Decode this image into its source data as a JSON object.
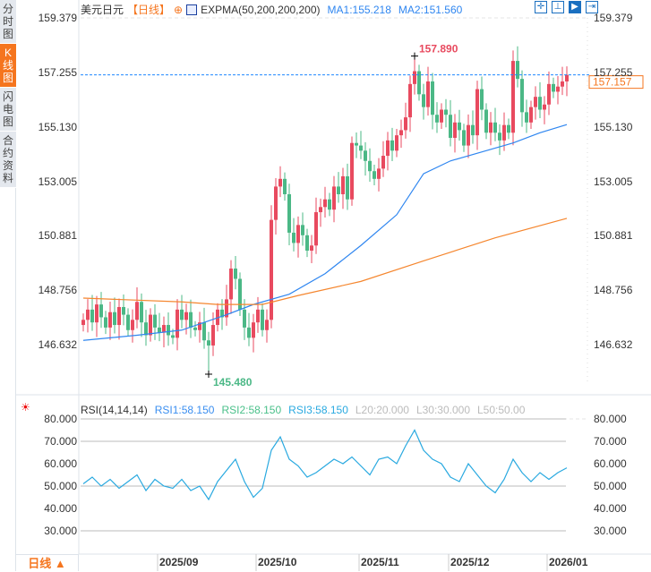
{
  "side_tabs": [
    {
      "label": "分\n时\n图",
      "active": false
    },
    {
      "label": "K\n线\n图",
      "active": true
    },
    {
      "label": "闪\n电\n图",
      "active": false
    },
    {
      "label": "合\n约\n资\n料",
      "active": false
    }
  ],
  "header": {
    "symbol": "美元日元",
    "period": "【日线】",
    "indicator": "EXPMA(50,200,200,200)",
    "ma1": "MA1:155.218",
    "ma2": "MA2:151.560"
  },
  "toolbar": [
    {
      "name": "crosshair",
      "active": false
    },
    {
      "name": "range",
      "active": false
    },
    {
      "name": "play",
      "active": true
    },
    {
      "name": "goto-end",
      "active": false
    }
  ],
  "price_axis": {
    "ticks": [
      "159.379",
      "157.255",
      "155.130",
      "153.005",
      "150.881",
      "148.756",
      "146.632"
    ],
    "tick_values": [
      159.379,
      157.255,
      155.13,
      153.005,
      150.881,
      148.756,
      146.632
    ],
    "current": "157.157",
    "current_value": 157.157
  },
  "annotations": {
    "high": "157.890",
    "high_value": 157.89,
    "high_index": 74,
    "low": "145.480",
    "low_value": 145.48,
    "low_index": 28
  },
  "colors": {
    "up": "#e84a5f",
    "down": "#4bb886",
    "ma1": "#2f86f0",
    "ma2": "#f5862e",
    "rsi": "#29a9e0",
    "accent": "#f5751e"
  },
  "chart_data": {
    "type": "candlestick",
    "close": [
      147.6,
      148.0,
      147.5,
      148.2,
      147.7,
      147.3,
      147.9,
      147.4,
      148.1,
      147.8,
      147.2,
      147.6,
      148.3,
      147.5,
      147.0,
      147.8,
      147.3,
      147.1,
      147.4,
      147.0,
      146.9,
      148.0,
      147.6,
      147.9,
      147.3,
      147.2,
      147.5,
      146.8,
      146.6,
      147.4,
      148.0,
      147.7,
      148.4,
      149.6,
      149.2,
      148.0,
      147.3,
      146.9,
      147.5,
      148.0,
      147.2,
      147.6,
      151.5,
      152.8,
      153.1,
      152.5,
      151.0,
      150.6,
      151.3,
      150.9,
      150.3,
      150.5,
      151.8,
      152.0,
      152.3,
      151.9,
      152.8,
      152.5,
      153.2,
      152.3,
      154.5,
      154.4,
      154.2,
      153.8,
      153.4,
      153.1,
      153.5,
      154.0,
      154.6,
      154.2,
      154.8,
      155.0,
      155.5,
      156.8,
      157.3,
      156.4,
      155.9,
      156.9,
      155.6,
      155.3,
      155.8,
      155.6,
      154.7,
      155.3,
      155.0,
      154.4,
      155.2,
      154.8,
      156.6,
      155.8,
      154.9,
      155.3,
      154.9,
      154.6,
      155.2,
      154.9,
      157.7,
      157.0,
      155.7,
      155.3,
      155.9,
      156.3,
      155.8,
      156.0,
      156.8,
      156.5,
      156.7,
      156.9,
      157.157
    ],
    "ma1": [
      [
        0,
        146.8
      ],
      [
        12,
        147.0
      ],
      [
        22,
        147.2
      ],
      [
        32,
        147.8
      ],
      [
        38,
        148.2
      ],
      [
        46,
        148.6
      ],
      [
        54,
        149.4
      ],
      [
        62,
        150.5
      ],
      [
        70,
        151.7
      ],
      [
        76,
        153.3
      ],
      [
        82,
        153.8
      ],
      [
        90,
        154.2
      ],
      [
        96,
        154.5
      ],
      [
        102,
        154.9
      ],
      [
        108,
        155.218
      ]
    ],
    "ma2": [
      [
        0,
        148.45
      ],
      [
        22,
        148.3
      ],
      [
        30,
        148.2
      ],
      [
        40,
        148.2
      ],
      [
        48,
        148.55
      ],
      [
        62,
        149.1
      ],
      [
        76,
        149.9
      ],
      [
        92,
        150.8
      ],
      [
        108,
        151.56
      ]
    ],
    "x_ticks": [
      {
        "label": "2025/09",
        "index": 21
      },
      {
        "label": "2025/10",
        "index": 43
      },
      {
        "label": "2025/11",
        "index": 66
      },
      {
        "label": "2025/12",
        "index": 86
      },
      {
        "label": "2026/01",
        "index": 108
      }
    ]
  },
  "rsi": {
    "title": "RSI(14,14,14)",
    "rsi1": "RSI1:58.150",
    "rsi2": "RSI2:58.150",
    "rsi3": "RSI3:58.150",
    "l20": "L20:20.000",
    "l30": "L30:30.000",
    "l50": "L50:50.00",
    "ticks": [
      "80.000",
      "70.000",
      "60.000",
      "50.000",
      "40.000",
      "30.000"
    ],
    "tick_values": [
      80,
      70,
      60,
      50,
      40,
      30
    ],
    "lines": [
      80,
      70,
      50,
      30
    ],
    "values": [
      [
        0,
        51
      ],
      [
        2,
        54
      ],
      [
        4,
        50
      ],
      [
        6,
        53
      ],
      [
        8,
        49
      ],
      [
        10,
        52
      ],
      [
        12,
        55
      ],
      [
        14,
        48
      ],
      [
        16,
        53
      ],
      [
        18,
        50
      ],
      [
        20,
        49
      ],
      [
        22,
        53
      ],
      [
        24,
        48
      ],
      [
        26,
        50
      ],
      [
        28,
        44
      ],
      [
        30,
        52
      ],
      [
        32,
        57
      ],
      [
        34,
        62
      ],
      [
        36,
        52
      ],
      [
        38,
        45
      ],
      [
        40,
        49
      ],
      [
        42,
        66
      ],
      [
        44,
        72
      ],
      [
        46,
        62
      ],
      [
        48,
        59
      ],
      [
        50,
        54
      ],
      [
        52,
        56
      ],
      [
        54,
        59
      ],
      [
        56,
        62
      ],
      [
        58,
        60
      ],
      [
        60,
        63
      ],
      [
        62,
        59
      ],
      [
        64,
        55
      ],
      [
        66,
        62
      ],
      [
        68,
        63
      ],
      [
        70,
        60
      ],
      [
        72,
        68
      ],
      [
        74,
        75
      ],
      [
        76,
        66
      ],
      [
        78,
        62
      ],
      [
        80,
        60
      ],
      [
        82,
        54
      ],
      [
        84,
        52
      ],
      [
        86,
        60
      ],
      [
        88,
        55
      ],
      [
        90,
        50
      ],
      [
        92,
        47
      ],
      [
        94,
        53
      ],
      [
        96,
        62
      ],
      [
        98,
        56
      ],
      [
        100,
        52
      ],
      [
        102,
        56
      ],
      [
        104,
        53
      ],
      [
        106,
        56
      ],
      [
        108,
        58.15
      ]
    ]
  },
  "footer": {
    "period_select": "日线 ▲"
  }
}
